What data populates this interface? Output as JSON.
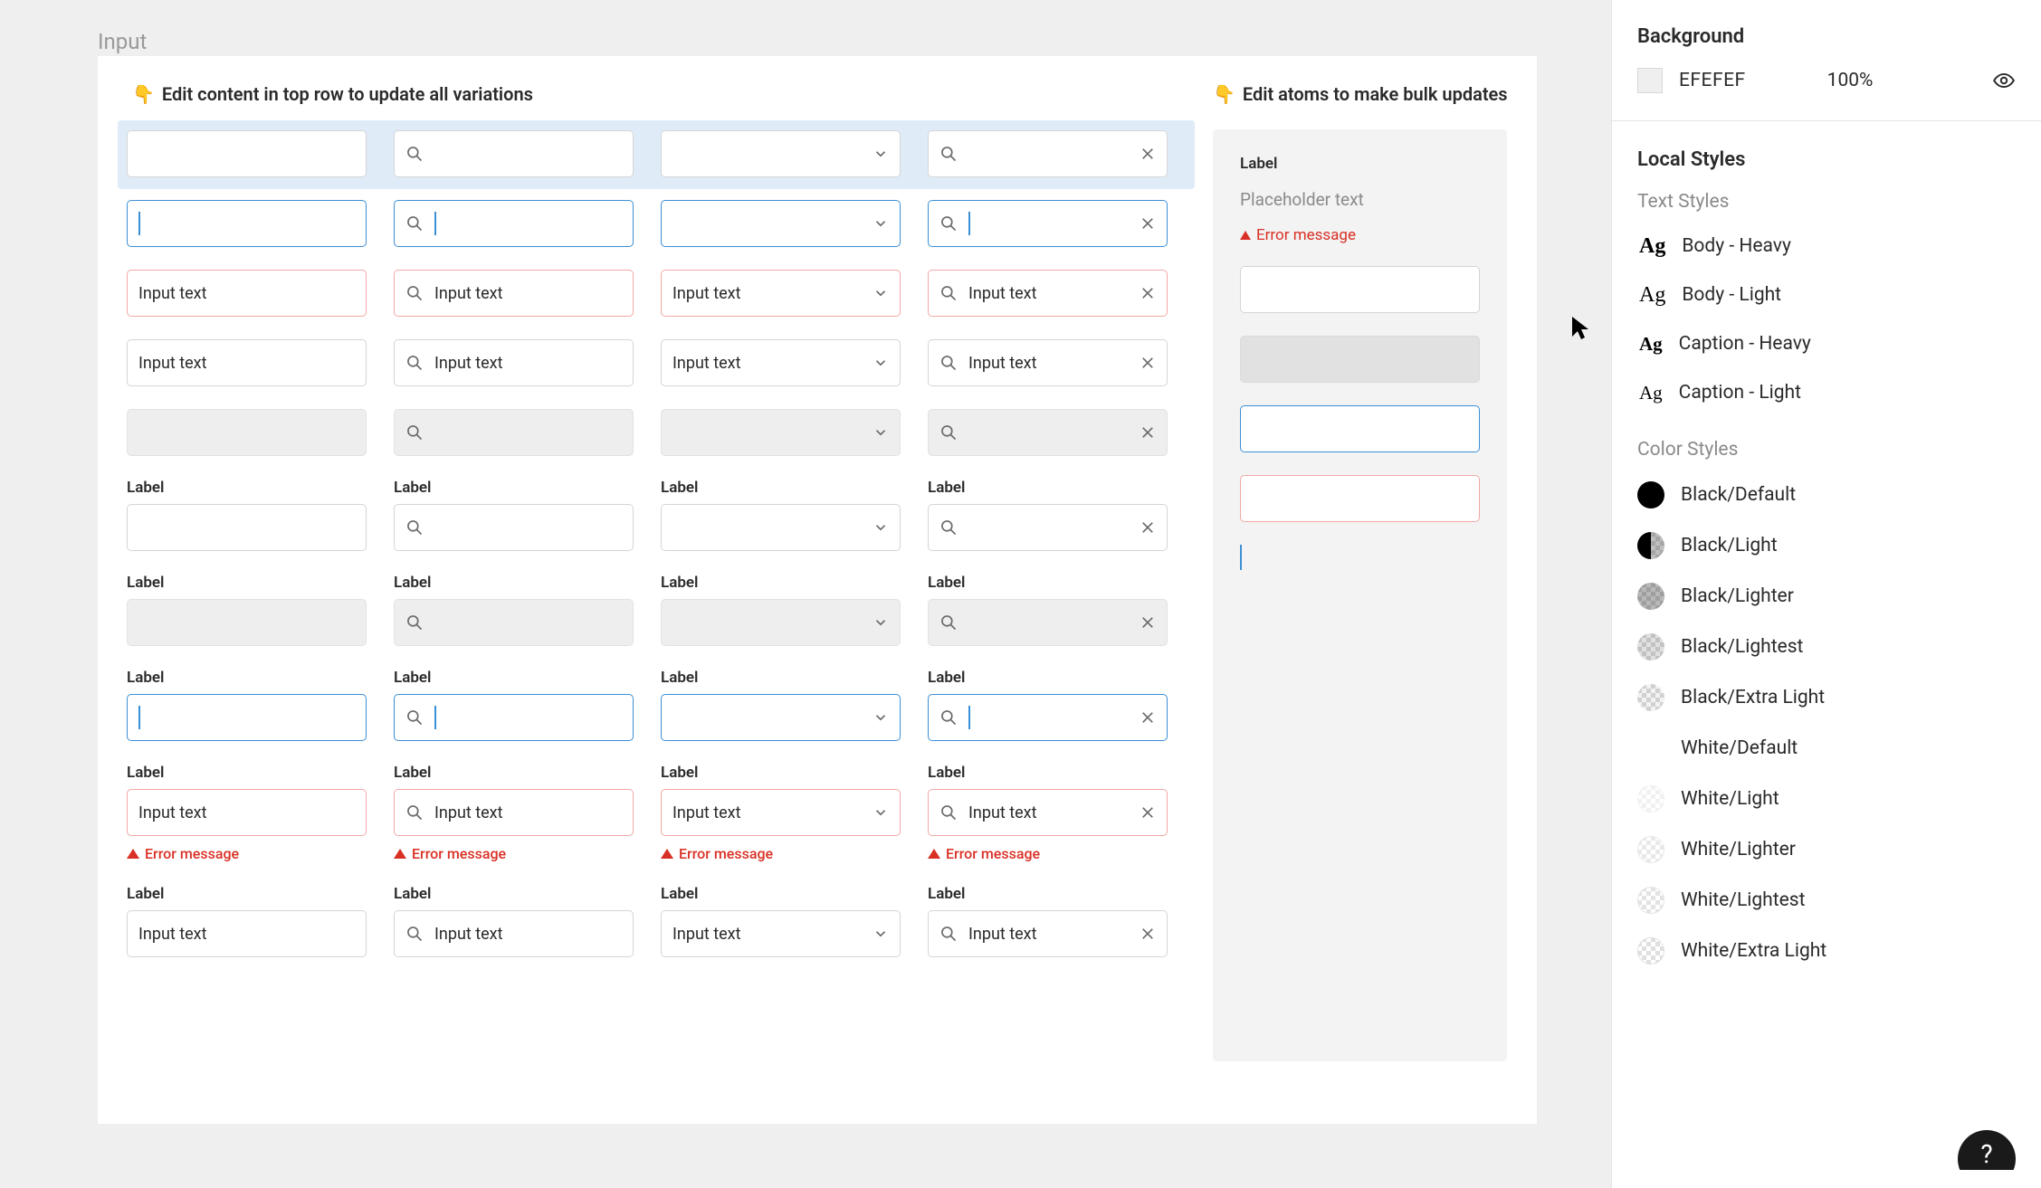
{
  "page_title": "Input",
  "hint_left": "Edit content in top row to update all variations",
  "hint_right": "Edit atoms to make bulk updates",
  "finger_emoji": "👇",
  "input_text": "Input text",
  "label_text": "Label",
  "error_text": "Error message",
  "atoms": {
    "label": "Label",
    "placeholder": "Placeholder text",
    "error": "Error message"
  },
  "side": {
    "bg_title": "Background",
    "bg_hex": "EFEFEF",
    "bg_pct": "100%",
    "local_styles": "Local Styles",
    "text_styles_header": "Text Styles",
    "text_styles": [
      {
        "name": "Body - Heavy",
        "weight": "heavy"
      },
      {
        "name": "Body - Light",
        "weight": "light"
      },
      {
        "name": "Caption - Heavy",
        "weight": "capheavy"
      },
      {
        "name": "Caption - Light",
        "weight": "caplight"
      }
    ],
    "color_styles_header": "Color Styles",
    "color_styles": [
      {
        "name": "Black/Default",
        "fill": "#000",
        "alpha": 1,
        "checker": false
      },
      {
        "name": "Black/Light",
        "fill": "#000",
        "alpha": 0.6,
        "checker": true,
        "half": true
      },
      {
        "name": "Black/Lighter",
        "fill": "#000",
        "alpha": 0.28,
        "checker": true
      },
      {
        "name": "Black/Lightest",
        "fill": "#000",
        "alpha": 0.12,
        "checker": true
      },
      {
        "name": "Black/Extra Light",
        "fill": "#000",
        "alpha": 0.05,
        "checker": true
      },
      {
        "name": "White/Default",
        "fill": "#fff",
        "alpha": 1,
        "checker": false,
        "border": true
      },
      {
        "name": "White/Light",
        "fill": "#fff",
        "alpha": 0.6,
        "checker": true,
        "border": true
      },
      {
        "name": "White/Lighter",
        "fill": "#fff",
        "alpha": 0.35,
        "checker": true,
        "border": true
      },
      {
        "name": "White/Lightest",
        "fill": "#fff",
        "alpha": 0.18,
        "checker": true,
        "border": true
      },
      {
        "name": "White/Extra Light",
        "fill": "#fff",
        "alpha": 0.08,
        "checker": true,
        "border": true
      }
    ]
  },
  "help": "?"
}
